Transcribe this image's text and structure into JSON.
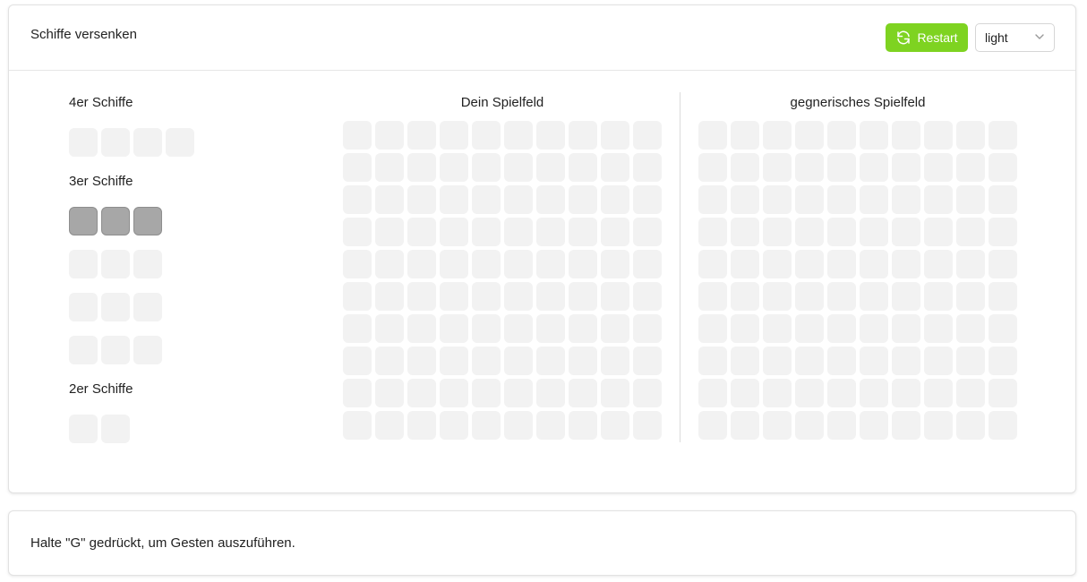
{
  "header": {
    "title": "Schiffe versenken",
    "restart_label": "Restart",
    "theme_value": "light"
  },
  "ships": {
    "four": {
      "heading": "4er Schiffe",
      "rows": [
        {
          "length": 4,
          "placed": false
        }
      ]
    },
    "three": {
      "heading": "3er Schiffe",
      "rows": [
        {
          "length": 3,
          "placed": true
        },
        {
          "length": 3,
          "placed": false
        },
        {
          "length": 3,
          "placed": false
        },
        {
          "length": 3,
          "placed": false
        }
      ]
    },
    "two": {
      "heading": "2er Schiffe",
      "rows": [
        {
          "length": 2,
          "placed": false
        }
      ]
    }
  },
  "boards": {
    "own": {
      "title": "Dein Spielfeld",
      "rows": 10,
      "cols": 10
    },
    "enemy": {
      "title": "gegnerisches Spielfeld",
      "rows": 10,
      "cols": 10
    }
  },
  "footer": {
    "hint": "Halte \"G\" gedrückt, um Gesten auszuführen."
  },
  "colors": {
    "accent": "#7ed321",
    "cell_empty": "#f2f2f2",
    "cell_placed": "#a7a7a7"
  },
  "icons": {
    "restart": "refresh-icon",
    "select": "chevron-down-icon"
  }
}
